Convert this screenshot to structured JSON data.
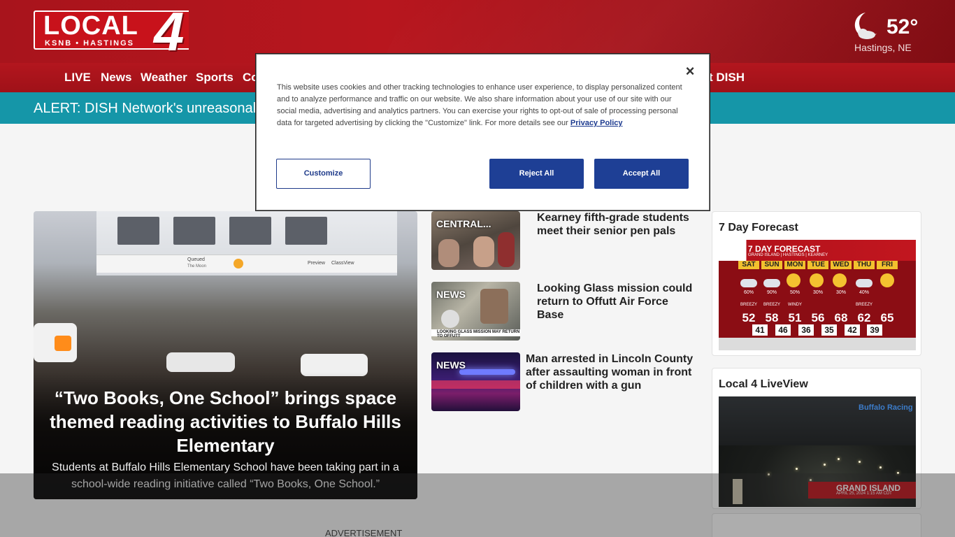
{
  "header": {
    "logo_text": "LOCAL",
    "logo_number": "4",
    "logo_sub": "KSNB • HASTINGS",
    "weather": {
      "temp": "52°",
      "location": "Hastings, NE",
      "icon": "moon-cloud-icon"
    }
  },
  "nav": {
    "items": [
      "LIVE",
      "News",
      "Weather",
      "Sports",
      "Co"
    ],
    "trailing": "t DISH"
  },
  "alert": {
    "text": "ALERT: DISH Network's unreasonal"
  },
  "hero": {
    "title": "“Two Books, One School” brings space themed reading activities to Buffalo Hills Elementary",
    "description": "Students at Buffalo Hills Elementary School have been taking part in a school-wide reading initiative called “Two Books, One School.”",
    "screen_labels": {
      "queued": "Queued",
      "the_moon": "The Moon",
      "preview": "Preview",
      "classview": "ClassView"
    }
  },
  "stories": [
    {
      "tag": "CENTRAL...",
      "title": "Kearney fifth-grade students meet their senior pen pals"
    },
    {
      "tag": "NEWS",
      "title": "Looking Glass mission could return to Offutt Air Force Base",
      "caption": "LOOKING GLASS MISSION MAY RETURN TO OFFUTT"
    },
    {
      "tag": "NEWS",
      "title": "Man arrested in Lincoln County after assaulting woman in front of children with a gun"
    }
  ],
  "sidebar": {
    "forecast": {
      "title": "7 Day Forecast",
      "heading": "7 DAY FORECAST",
      "subheading": "GRAND ISLAND | HASTINGS | KEARNEY",
      "days": [
        {
          "day": "SAT",
          "pct": "60%",
          "note": "BREEZY",
          "high": "52",
          "low": "41"
        },
        {
          "day": "SUN",
          "pct": "90%",
          "note": "BREEZY",
          "high": "58",
          "low": "46"
        },
        {
          "day": "MON",
          "pct": "50%",
          "note": "WINDY",
          "high": "51",
          "low": "36"
        },
        {
          "day": "TUE",
          "pct": "30%",
          "note": "",
          "high": "56",
          "low": "35"
        },
        {
          "day": "WED",
          "pct": "30%",
          "note": "",
          "high": "68",
          "low": "42"
        },
        {
          "day": "THU",
          "pct": "40%",
          "note": "BREEZY",
          "high": "62",
          "low": "39"
        },
        {
          "day": "FRI",
          "pct": "",
          "note": "",
          "high": "65",
          "low": ""
        }
      ]
    },
    "liveview": {
      "title": "Local 4 LiveView",
      "location": "GRAND ISLAND",
      "timestamp": "APRIL 25, 2024 1:15 AM CDT",
      "watermark": "Buffalo Racing"
    }
  },
  "advertisement": "ADVERTISEMENT",
  "cookie": {
    "text": "This website uses cookies and other tracking technologies to enhance user experience, to display personalized content and to analyze performance and traffic on our website. We also share information about your use of our site with our social media, advertising and analytics partners. You can exercise your rights to opt-out of sale of processing personal data for targeted advertising by clicking the \"Customize\" link. For more details see our",
    "link": "Privacy Policy",
    "customize": "Customize",
    "reject": "Reject All",
    "accept": "Accept All",
    "close": "×"
  }
}
